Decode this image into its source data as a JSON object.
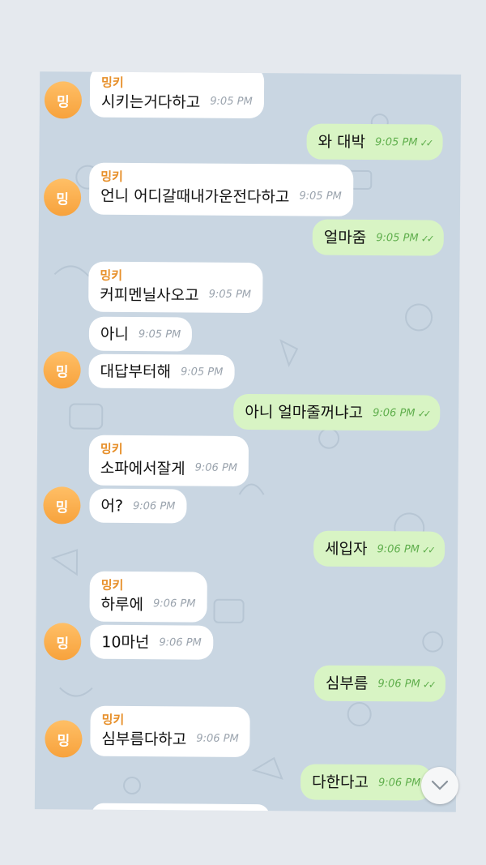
{
  "contact": {
    "name": "밍키",
    "avatar_text": "밍"
  },
  "messages": [
    {
      "dir": "in",
      "text": "시키는거다하고",
      "time": "9:05 PM"
    },
    {
      "dir": "out",
      "text": "와 대박",
      "time": "9:05 PM"
    },
    {
      "dir": "in",
      "text": "언니 어디갈때내가운전다하고",
      "time": "9:05 PM"
    },
    {
      "dir": "out",
      "text": "얼마줌",
      "time": "9:05 PM"
    },
    {
      "dir": "in",
      "text": "커피멘닐사오고",
      "time": "9:05 PM"
    },
    {
      "dir": "in",
      "text": "아니",
      "time": "9:05 PM"
    },
    {
      "dir": "in",
      "text": "대답부터해",
      "time": "9:05 PM"
    },
    {
      "dir": "out",
      "text": "아니 얼마줄꺼냐고",
      "time": "9:06 PM"
    },
    {
      "dir": "in",
      "text": "소파에서잘게",
      "time": "9:06 PM"
    },
    {
      "dir": "in",
      "text": "어?",
      "time": "9:06 PM"
    },
    {
      "dir": "out",
      "text": "세입자",
      "time": "9:06 PM"
    },
    {
      "dir": "in",
      "text": "하루에",
      "time": "9:06 PM"
    },
    {
      "dir": "in",
      "text": "10마넌",
      "time": "9:06 PM"
    },
    {
      "dir": "out",
      "text": "심부름",
      "time": "9:06 PM"
    },
    {
      "dir": "in",
      "text": "심부름다하고",
      "time": "9:06 PM"
    },
    {
      "dir": "out",
      "text": "다한다고",
      "time": "9:06 PM"
    }
  ]
}
